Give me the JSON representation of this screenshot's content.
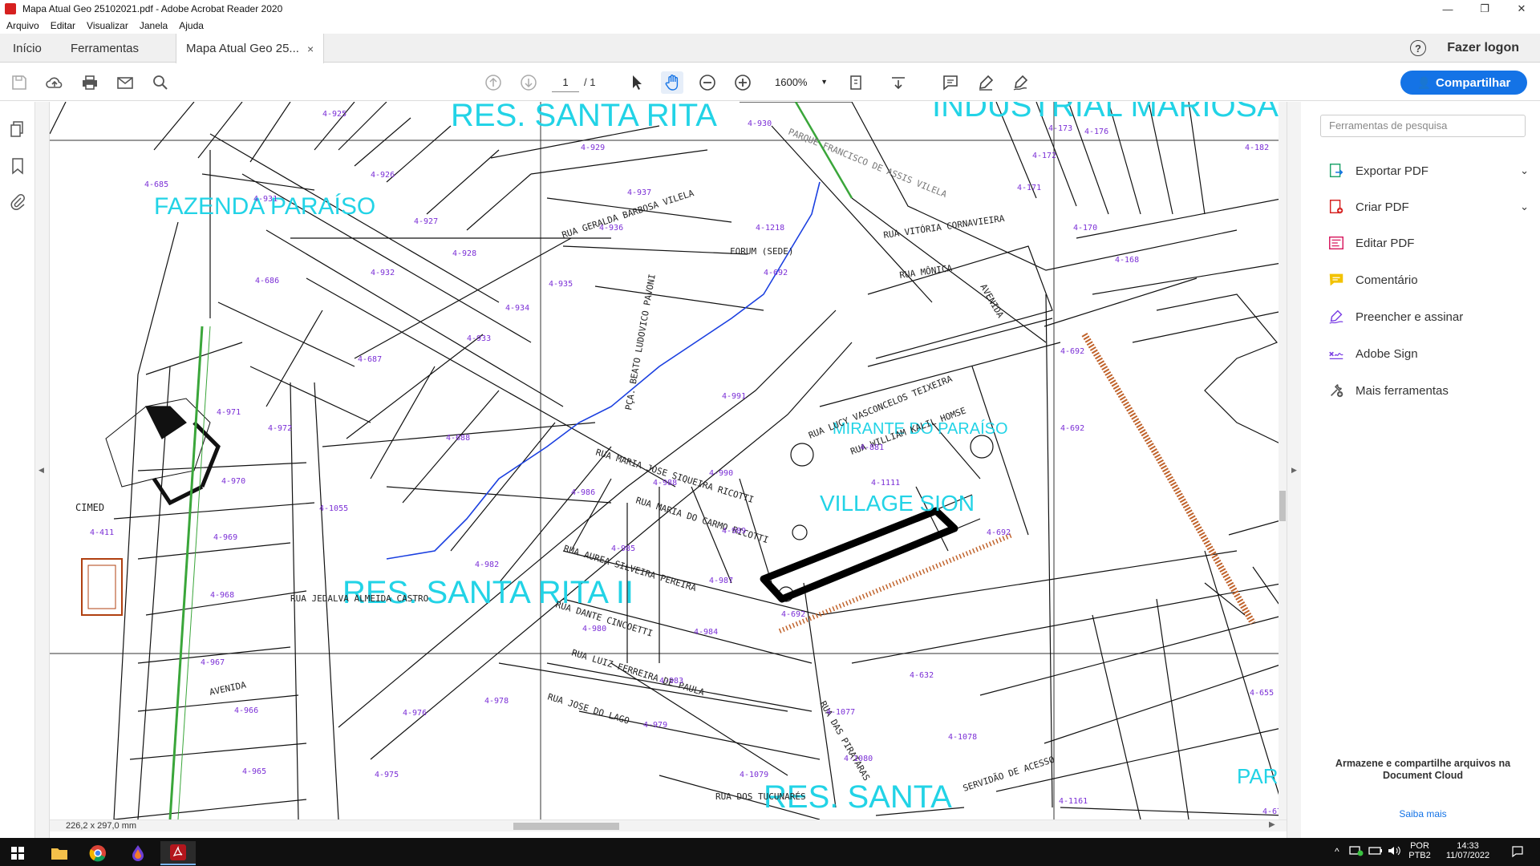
{
  "window": {
    "title": "Mapa Atual Geo 25102021.pdf - Adobe Acrobat Reader 2020",
    "controls": {
      "minimize": "—",
      "maximize": "❐",
      "close": "✕"
    }
  },
  "menu": [
    "Arquivo",
    "Editar",
    "Visualizar",
    "Janela",
    "Ajuda"
  ],
  "tabs": {
    "home": "Início",
    "tools": "Ferramentas",
    "doc": "Mapa Atual Geo 25...",
    "close": "×"
  },
  "header": {
    "help": "?",
    "login": "Fazer logon"
  },
  "toolbar": {
    "page_current": "1",
    "page_total": "/ 1",
    "zoom": "1600%",
    "share": "Compartilhar"
  },
  "tools_panel": {
    "search_placeholder": "Ferramentas de pesquisa",
    "items": [
      {
        "label": "Exportar PDF",
        "icon": "export-pdf-icon",
        "expandable": true
      },
      {
        "label": "Criar PDF",
        "icon": "create-pdf-icon",
        "expandable": true
      },
      {
        "label": "Editar PDF",
        "icon": "edit-pdf-icon",
        "expandable": false
      },
      {
        "label": "Comentário",
        "icon": "comment-icon",
        "expandable": false
      },
      {
        "label": "Preencher e assinar",
        "icon": "fill-sign-icon",
        "expandable": false
      },
      {
        "label": "Adobe Sign",
        "icon": "adobe-sign-icon",
        "expandable": false
      },
      {
        "label": "Mais ferramentas",
        "icon": "more-tools-icon",
        "expandable": false
      }
    ],
    "cloud_message": "Armazene e compartilhe arquivos na Document Cloud",
    "cloud_link": "Saiba mais"
  },
  "status": {
    "page_size": "226,2 x 297,0 mm"
  },
  "map": {
    "regions": [
      "RES. SANTA RITA",
      "FAZENDA PARAÍSO",
      "INDUSTRIAL MARIOSA",
      "MIRANTE DO PARAÍSO",
      "VILLAGE SION",
      "RES. SANTA RITA II",
      "RES. SANTA",
      "PAR"
    ],
    "labels": [
      "PARQUE FRANCISCO DE ASSIS VILELA",
      "FORUM (SEDE)",
      "CIMED",
      "PÇA. BEATO LUDOVICO PAVONI",
      "RUA JEDALVA ALMEIDA CASTRO",
      "RUA GERALDA BARBOSA VILELA",
      "RUA LUCY VASCONCELOS TEIXEIRA",
      "RUA WILLIAM KALIL HOMSE",
      "RUA MARIA JOSE SIQUEIRA RICOTTI",
      "RUA MARIA DO CARMO RICOTTI",
      "RUA AUREA SILVEIRA PEREIRA",
      "RUA DANTE CINCOETTI",
      "RUA LUIZ FERREIRA DE PAULA",
      "RUA JOSE DO LAGO",
      "AVENIDA",
      "RUA DAS PIRATARAS",
      "RUA DOS TUCUNARÉS",
      "SERVIDÃO DE ACESSO",
      "RUA MÔNICA",
      "RUA VITÓRIA CORNAVIEIRA",
      "4-692",
      "4-632",
      "4-1111",
      "4-881",
      "4-1218",
      "4-991",
      "4-990",
      "4-989",
      "4-987",
      "4-985",
      "4-984",
      "4-983",
      "4-979",
      "4-1077",
      "4-1080",
      "4-1079",
      "4-1078",
      "4-1161",
      "4-655",
      "4-67",
      "4-1055",
      "4-411",
      "4-685",
      "4-686",
      "4-687",
      "4-688",
      "4-971",
      "4-972",
      "4-970",
      "4-969",
      "4-968",
      "4-967",
      "4-966",
      "4-965",
      "4-975",
      "4-976",
      "4-978",
      "4-980",
      "4-982",
      "4-986",
      "4-988",
      "4-925",
      "4-926",
      "4-927",
      "4-928",
      "4-929",
      "4-931",
      "4-932",
      "4-933",
      "4-934",
      "4-935",
      "4-936",
      "4-937",
      "4-930",
      "4-170",
      "4-168",
      "4-171",
      "4-172",
      "4-176",
      "4-182",
      "4-173"
    ]
  },
  "taskbar": {
    "lang1": "POR",
    "lang2": "PTB2",
    "time": "14:33",
    "date": "11/07/2022"
  },
  "colors": {
    "accent": "#1473e6",
    "map_region_label": "#22d3e6",
    "lot_number": "#7b2fd6",
    "stream": "#1a3fe0",
    "taskbar": "#101010"
  }
}
